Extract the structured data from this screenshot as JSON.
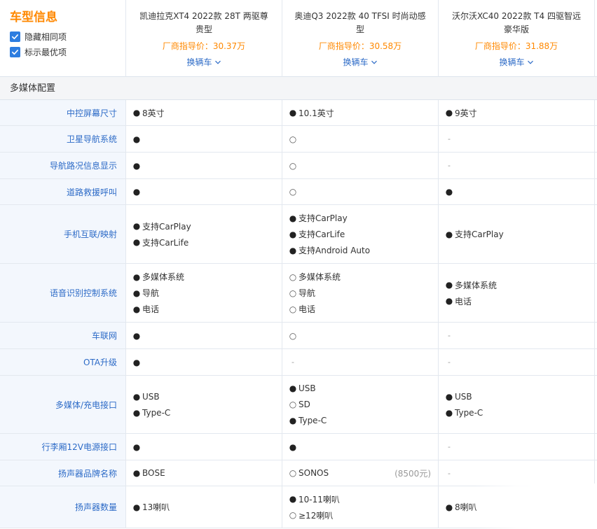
{
  "header": {
    "title": "车型信息",
    "hide_same": "隐藏相同项",
    "mark_best": "标示最优项",
    "cars": [
      {
        "name": "凯迪拉克XT4 2022款 28T 两驱尊贵型",
        "price": "厂商指导价：30.37万",
        "change": "换辆车"
      },
      {
        "name": "奥迪Q3 2022款 40 TFSI 时尚动感型",
        "price": "厂商指导价：30.58万",
        "change": "换辆车"
      },
      {
        "name": "沃尔沃XC40 2022款 T4 四驱智远豪华版",
        "price": "厂商指导价：31.88万",
        "change": "换辆车"
      }
    ]
  },
  "section": {
    "label": "多媒体配置"
  },
  "legend": {
    "standard": "●",
    "optional": "○",
    "none": "-"
  },
  "rows": [
    {
      "label": "中控屏幕尺寸",
      "height": 37,
      "cells": [
        [
          {
            "m": "std",
            "t": "8英寸"
          }
        ],
        [
          {
            "m": "std",
            "t": "10.1英寸"
          }
        ],
        [
          {
            "m": "std",
            "t": "9英寸"
          }
        ]
      ]
    },
    {
      "label": "卫星导航系统",
      "height": 38,
      "cells": [
        [
          {
            "m": "std",
            "t": ""
          }
        ],
        [
          {
            "m": "opt",
            "t": ""
          }
        ],
        [
          {
            "m": "none",
            "t": ""
          }
        ]
      ]
    },
    {
      "label": "导航路况信息显示",
      "height": 38,
      "cells": [
        [
          {
            "m": "std",
            "t": ""
          }
        ],
        [
          {
            "m": "opt",
            "t": ""
          }
        ],
        [
          {
            "m": "none",
            "t": ""
          }
        ]
      ]
    },
    {
      "label": "道路救援呼叫",
      "height": 37,
      "cells": [
        [
          {
            "m": "std",
            "t": ""
          }
        ],
        [
          {
            "m": "opt",
            "t": ""
          }
        ],
        [
          {
            "m": "std",
            "t": ""
          }
        ]
      ]
    },
    {
      "label": "手机互联/映射",
      "height": 84,
      "cells": [
        [
          {
            "m": "std",
            "t": "支持CarPlay"
          },
          {
            "m": "std",
            "t": "支持CarLife"
          }
        ],
        [
          {
            "m": "std",
            "t": "支持CarPlay"
          },
          {
            "m": "std",
            "t": "支持CarLife"
          },
          {
            "m": "std",
            "t": "支持Android Auto"
          }
        ],
        [
          {
            "m": "std",
            "t": "支持CarPlay"
          }
        ]
      ]
    },
    {
      "label": "语音识别控制系统",
      "height": 84,
      "cells": [
        [
          {
            "m": "std",
            "t": "多媒体系统"
          },
          {
            "m": "std",
            "t": "导航"
          },
          {
            "m": "std",
            "t": "电话"
          }
        ],
        [
          {
            "m": "opt",
            "t": "多媒体系统"
          },
          {
            "m": "opt",
            "t": "导航"
          },
          {
            "m": "opt",
            "t": "电话"
          }
        ],
        [
          {
            "m": "std",
            "t": "多媒体系统"
          },
          {
            "m": "std",
            "t": "电话"
          }
        ]
      ]
    },
    {
      "label": "车联网",
      "height": 38,
      "cells": [
        [
          {
            "m": "std",
            "t": ""
          }
        ],
        [
          {
            "m": "opt",
            "t": ""
          }
        ],
        [
          {
            "m": "none",
            "t": ""
          }
        ]
      ]
    },
    {
      "label": "OTA升级",
      "height": 38,
      "cells": [
        [
          {
            "m": "std",
            "t": ""
          }
        ],
        [
          {
            "m": "none",
            "t": ""
          }
        ],
        [
          {
            "m": "none",
            "t": ""
          }
        ]
      ]
    },
    {
      "label": "多媒体/充电接口",
      "height": 83,
      "cells": [
        [
          {
            "m": "std",
            "t": "USB"
          },
          {
            "m": "std",
            "t": "Type-C"
          }
        ],
        [
          {
            "m": "std",
            "t": "USB"
          },
          {
            "m": "opt",
            "t": "SD"
          },
          {
            "m": "std",
            "t": "Type-C"
          }
        ],
        [
          {
            "m": "std",
            "t": "USB"
          },
          {
            "m": "std",
            "t": "Type-C"
          }
        ]
      ]
    },
    {
      "label": "行李厢12V电源接口",
      "height": 38,
      "cells": [
        [
          {
            "m": "std",
            "t": ""
          }
        ],
        [
          {
            "m": "std",
            "t": ""
          }
        ],
        [
          {
            "m": "none",
            "t": ""
          }
        ]
      ]
    },
    {
      "label": "扬声器品牌名称",
      "height": 37,
      "cells": [
        [
          {
            "m": "std",
            "t": "BOSE"
          }
        ],
        [
          {
            "m": "opt",
            "t": "SONOS",
            "note": "(8500元)"
          }
        ],
        [
          {
            "m": "none",
            "t": ""
          }
        ]
      ]
    },
    {
      "label": "扬声器数量",
      "height": 60,
      "cells": [
        [
          {
            "m": "std",
            "t": "13喇叭"
          }
        ],
        [
          {
            "m": "std",
            "t": "10-11喇叭"
          },
          {
            "m": "opt",
            "t": "≥12喇叭"
          }
        ],
        [
          {
            "m": "std",
            "t": "8喇叭"
          }
        ]
      ]
    }
  ]
}
